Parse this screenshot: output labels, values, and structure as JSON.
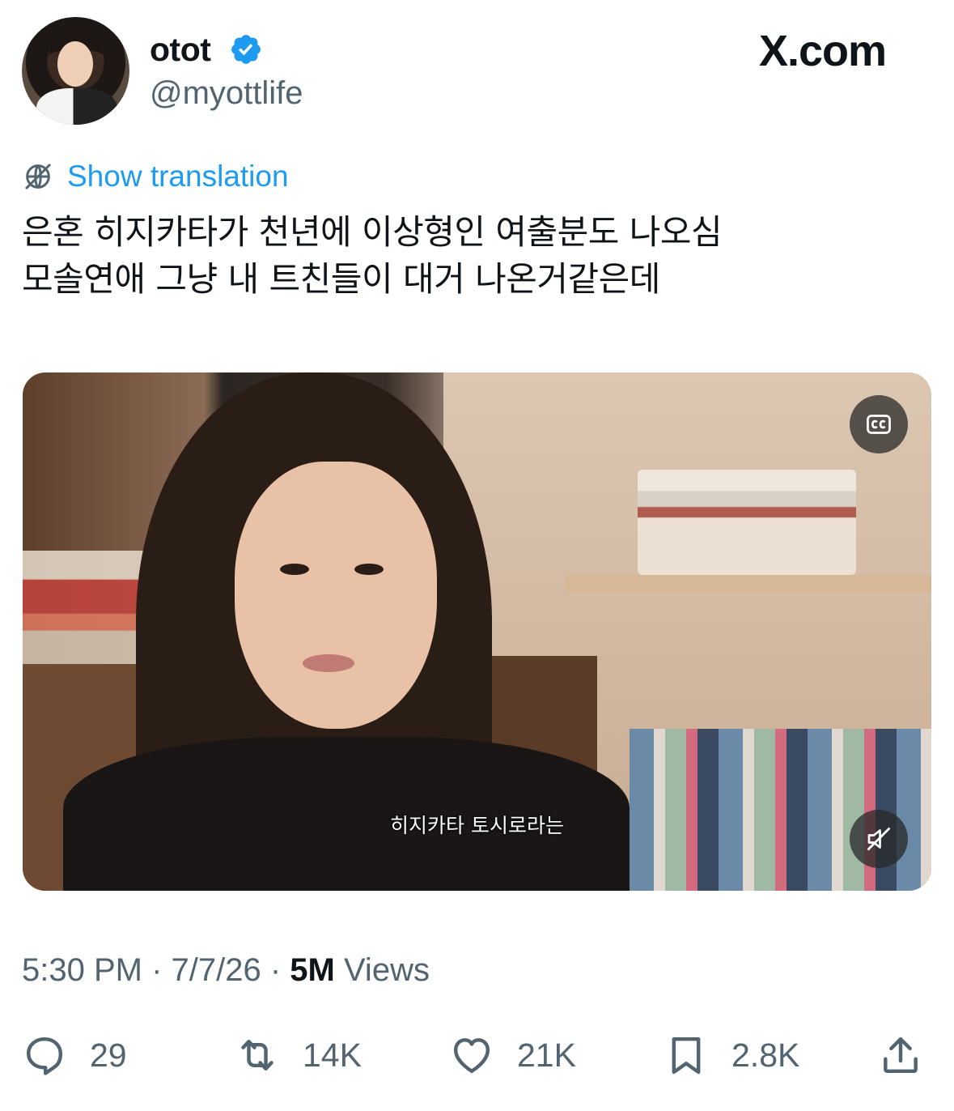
{
  "header": {
    "display_name": "otot",
    "handle": "@myottlife",
    "brand": "X.com",
    "avatar_icon": "profile-photo",
    "verified_icon": "verified-badge-icon",
    "verified_color": "#1d9bf0"
  },
  "translation": {
    "label": "Show translation",
    "icon": "globe-slash-icon",
    "color": "#1d9bf0"
  },
  "tweet": {
    "lines": [
      "은혼 히지카타가 천년에 이상형인 여출분도 나오심",
      "모솔연애 그냥 내 트친들이 대거 나온거같은데"
    ]
  },
  "media": {
    "subtitle": "히지카타 토시로라는",
    "cc_icon": "closed-captions-icon",
    "mute_icon": "muted-speaker-icon"
  },
  "meta": {
    "time": "5:30 PM",
    "sep1": " · ",
    "date": "7/7/26",
    "sep2": " · ",
    "views_count": "5M",
    "views_label": " Views"
  },
  "actions": {
    "replies": {
      "icon": "reply-icon",
      "count": "29"
    },
    "reposts": {
      "icon": "repost-icon",
      "count": "14K"
    },
    "likes": {
      "icon": "heart-icon",
      "count": "21K"
    },
    "bookmarks": {
      "icon": "bookmark-icon",
      "count": "2.8K"
    },
    "share": {
      "icon": "share-icon"
    }
  },
  "colors": {
    "text": "#0f1419",
    "secondary": "#536471",
    "accent": "#1d9bf0"
  }
}
